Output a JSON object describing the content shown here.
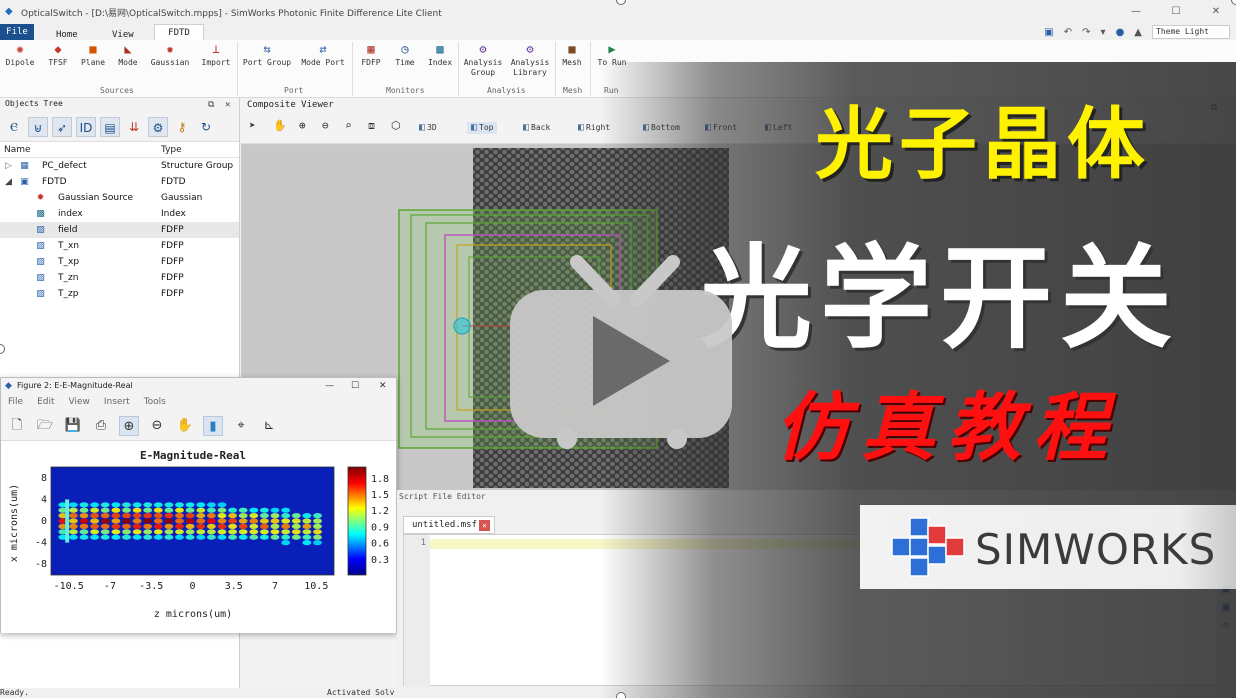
{
  "app": {
    "title": "OpticalSwitch - [D:\\易网\\OpticalSwitch.mpps] - SimWorks Photonic Finite Difference Lite Client"
  },
  "menu_tabs": {
    "file": "File",
    "home": "Home",
    "view": "View",
    "fdtd": "FDTD"
  },
  "theme": {
    "selected": "Theme Light"
  },
  "ribbon": {
    "sources": [
      "Dipole",
      "TFSF",
      "Plane",
      "Mode",
      "Gaussian",
      "Import"
    ],
    "sources_label": "Sources",
    "port": [
      "Port Group",
      "Mode Port"
    ],
    "port_label": "Port",
    "monitors": [
      "FDFP",
      "Time",
      "Index"
    ],
    "monitors_label": "Monitors",
    "analysis": [
      "Analysis Group",
      "Analysis Library"
    ],
    "analysis_label": "Analysis",
    "mesh": "Mesh",
    "mesh_label": "Mesh",
    "run": "To Run",
    "run_label": "Run"
  },
  "objects_tree": {
    "title": "Objects Tree",
    "col_name": "Name",
    "col_type": "Type",
    "rows": [
      {
        "name": "PC_defect",
        "type": "Structure Group"
      },
      {
        "name": "FDTD",
        "type": "FDTD"
      },
      {
        "name": "Gaussian Source",
        "type": "Gaussian"
      },
      {
        "name": "index",
        "type": "Index"
      },
      {
        "name": "field",
        "type": "FDFP"
      },
      {
        "name": "T_xn",
        "type": "FDFP"
      },
      {
        "name": "T_xp",
        "type": "FDFP"
      },
      {
        "name": "T_zn",
        "type": "FDFP"
      },
      {
        "name": "T_zp",
        "type": "FDFP"
      }
    ]
  },
  "viewer": {
    "title": "Composite Viewer",
    "views": [
      "3D",
      "Top",
      "Back",
      "Right",
      "Bottom",
      "Front",
      "Left"
    ]
  },
  "figure": {
    "title": "Figure 2: E-E-Magnitude-Real",
    "menu": [
      "File",
      "Edit",
      "View",
      "Insert",
      "Tools"
    ]
  },
  "chart_data": {
    "type": "heatmap",
    "title": "E-Magnitude-Real",
    "xlabel": "z microns(um)",
    "ylabel": "x microns(um)",
    "xticks": [
      "-10.5",
      "-7",
      "-3.5",
      "0",
      "3.5",
      "7",
      "10.5"
    ],
    "yticks": [
      "8",
      "4",
      "0",
      "-4",
      "-8"
    ],
    "xlim": [
      -12,
      12
    ],
    "ylim": [
      -10,
      10
    ],
    "colorbar_ticks": [
      "1.8",
      "1.5",
      "1.2",
      "0.9",
      "0.6",
      "0.3"
    ],
    "colorbar_range": [
      0,
      2.0
    ],
    "colormap": [
      "#00008f",
      "#0000ff",
      "#00ffff",
      "#ffff00",
      "#ff0000",
      "#800000"
    ]
  },
  "script": {
    "title": "Script File Editor",
    "tab": "untitled.msf",
    "line": "1"
  },
  "status": {
    "left": "Ready.",
    "right": "Activated Solv"
  },
  "overlay": {
    "line1": "光子晶体",
    "line2": "光学开关",
    "line3": "仿真教程",
    "brand": "SIMWORKS",
    "line1_color": "#fff200",
    "line3_color": "#ff1010"
  }
}
